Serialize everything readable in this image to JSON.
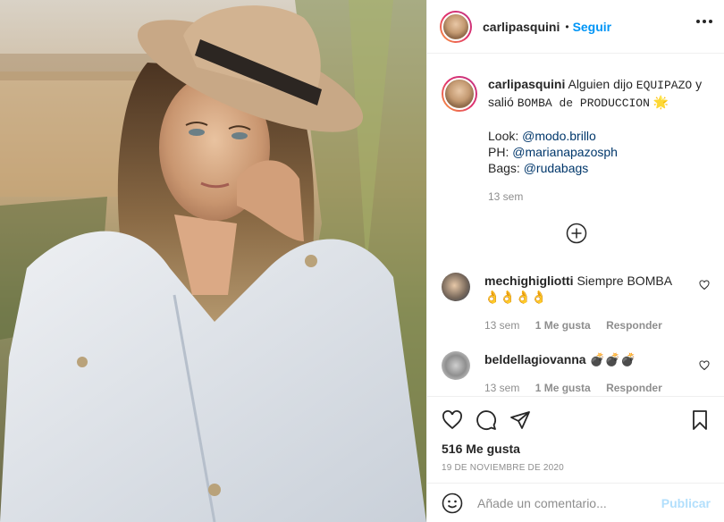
{
  "post_author": "carlipasquini",
  "follow_label": "Seguir",
  "separator": "•",
  "caption": {
    "username": "carlipasquini",
    "text_1": "Alguien dijo",
    "text_2": "EQUIPAZO",
    "text_3": "y salió",
    "text_4": "BOMBA de PRODUCCION",
    "emoji": "🌟",
    "look_label": "Look:",
    "look_handle": "@modo.brillo",
    "ph_label": "PH:",
    "ph_handle": "@marianapazosph",
    "bags_label": "Bags:",
    "bags_handle": "@rudabags",
    "time": "13 sem"
  },
  "comments": [
    {
      "username": "mechighigliotti",
      "text": "Siempre BOMBA",
      "emoji": "👌👌👌👌",
      "time": "13 sem",
      "likes": "1 Me gusta",
      "reply": "Responder"
    },
    {
      "username": "beldellagiovanna",
      "text": "",
      "emoji": "💣💣💣",
      "time": "13 sem",
      "likes": "1 Me gusta",
      "reply": "Responder"
    }
  ],
  "likes_count": "516 Me gusta",
  "post_date": "19 DE NOVIEMBRE DE 2020",
  "comment_placeholder": "Añade un comentario...",
  "publish_label": "Publicar",
  "icons": {
    "like": "heart-icon",
    "comment": "comment-icon",
    "share": "send-icon",
    "save": "bookmark-icon",
    "emoji": "smiley-icon",
    "more": "more-icon",
    "load_more": "plus-circle-icon"
  },
  "colors": {
    "accent": "#0095f6",
    "text": "#262626",
    "muted": "#8e8e8e",
    "link": "#00376b"
  }
}
